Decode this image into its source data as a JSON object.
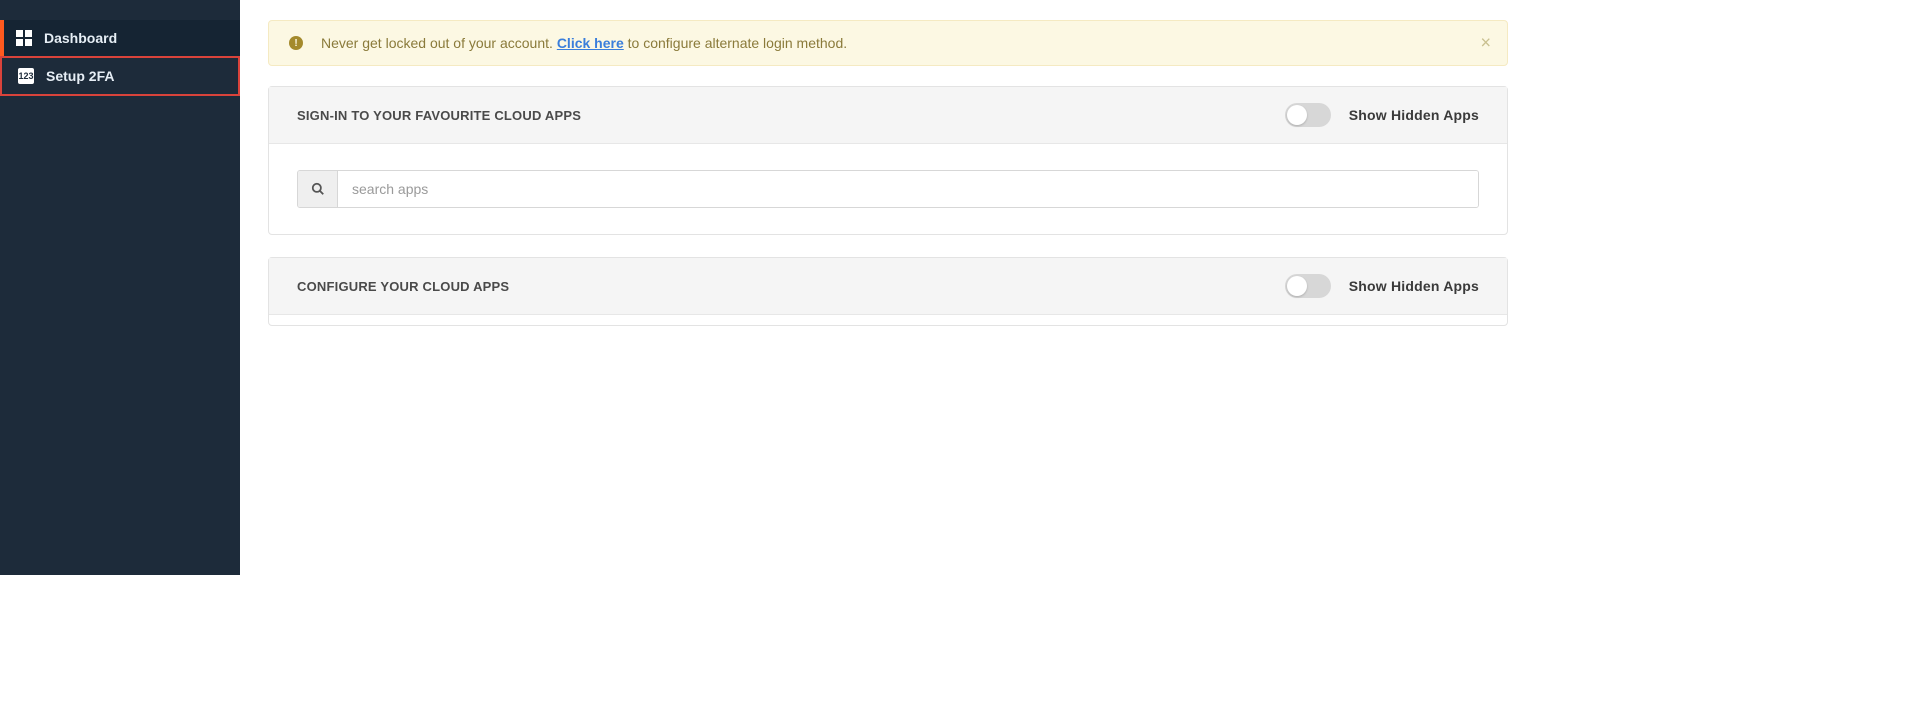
{
  "sidebar": {
    "items": [
      {
        "label": "Dashboard",
        "icon": "dashboard-icon"
      },
      {
        "label": "Setup 2FA",
        "icon": "digits-icon",
        "icon_text": "123"
      }
    ]
  },
  "alert": {
    "text_before": "Never get locked out of your account. ",
    "link_text": "Click here",
    "text_after": " to configure alternate login method."
  },
  "panels": {
    "signin": {
      "title": "SIGN-IN TO YOUR FAVOURITE CLOUD APPS",
      "toggle_label": "Show Hidden Apps",
      "search_placeholder": "search apps"
    },
    "configure": {
      "title": "CONFIGURE YOUR CLOUD APPS",
      "toggle_label": "Show Hidden Apps"
    }
  }
}
